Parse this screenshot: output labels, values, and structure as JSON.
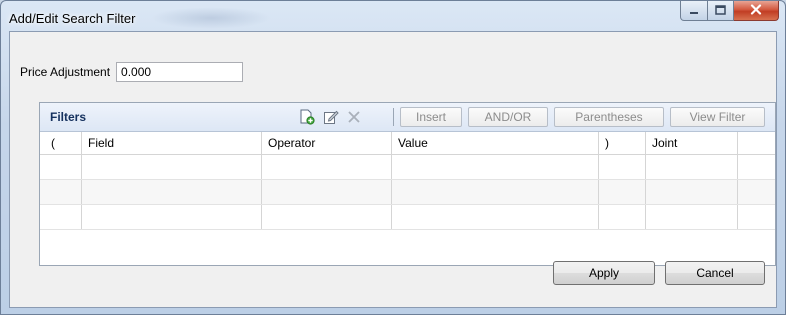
{
  "window": {
    "title": "Add/Edit Search Filter",
    "controls": {
      "minimize_icon": "minimize-icon",
      "maximize_icon": "maximize-icon",
      "close_icon": "close-icon"
    }
  },
  "price_adjustment": {
    "label": "Price Adjustment",
    "value": "0.000"
  },
  "filters": {
    "title": "Filters",
    "toolbar": {
      "icons": [
        "add-filter-icon",
        "edit-filter-icon",
        "delete-filter-icon"
      ],
      "insert_label": "Insert",
      "andor_label": "AND/OR",
      "parentheses_label": "Parentheses",
      "view_filter_label": "View Filter"
    },
    "columns": [
      "(",
      "Field",
      "Operator",
      "Value",
      ")",
      "Joint",
      ""
    ],
    "rows": [
      [
        "",
        "",
        "",
        "",
        "",
        "",
        ""
      ],
      [
        "",
        "",
        "",
        "",
        "",
        "",
        ""
      ],
      [
        "",
        "",
        "",
        "",
        "",
        "",
        ""
      ]
    ]
  },
  "buttons": {
    "apply_label": "Apply",
    "cancel_label": "Cancel"
  },
  "colors": {
    "accent_header": "#dde7f5",
    "close_button": "#c13d24",
    "title_text": "#000000"
  }
}
